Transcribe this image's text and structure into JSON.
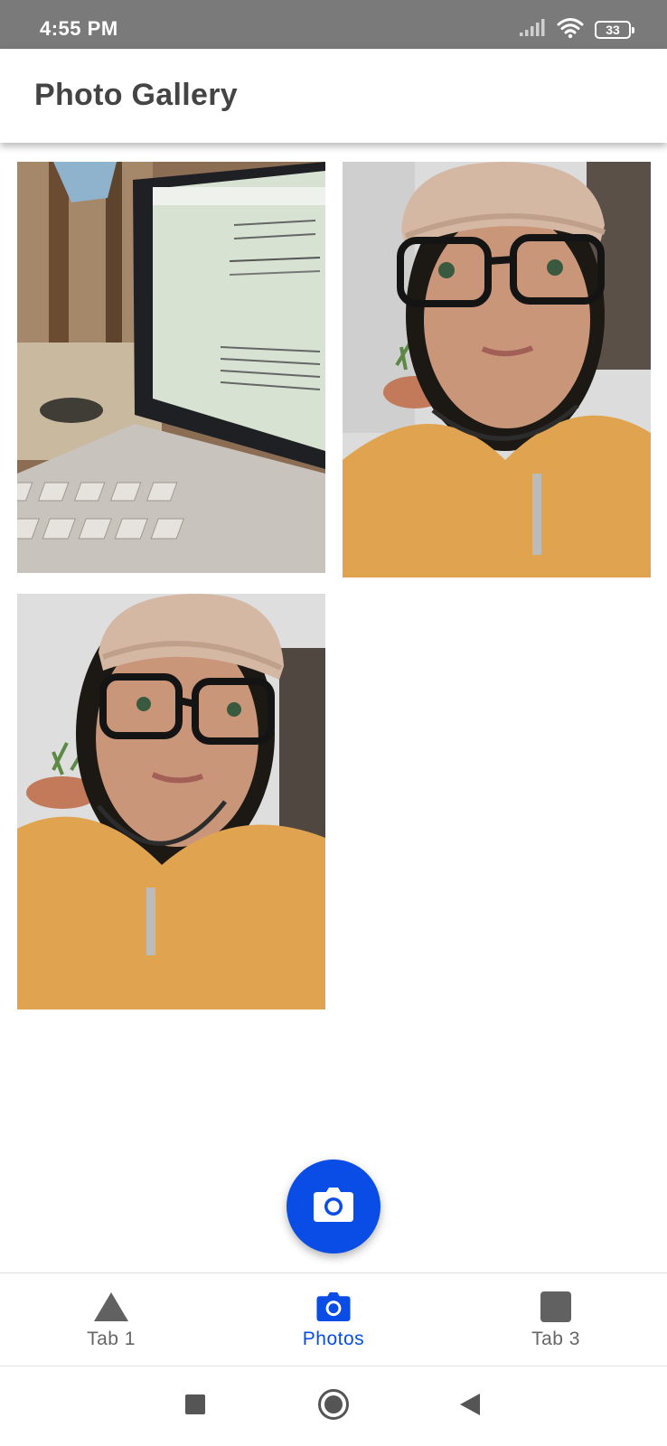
{
  "status_bar": {
    "time": "4:55 PM",
    "battery_level": "33",
    "icons": [
      "signal-icon",
      "wifi-icon",
      "battery-icon"
    ]
  },
  "header": {
    "title": "Photo Gallery"
  },
  "gallery": {
    "photos": [
      {
        "name": "photo-laptop",
        "subject": "laptop-with-document"
      },
      {
        "name": "photo-selfie-1",
        "subject": "selfie"
      },
      {
        "name": "photo-selfie-2",
        "subject": "selfie"
      }
    ]
  },
  "fab": {
    "icon": "camera-icon",
    "color": "#0a4de6"
  },
  "tabs": [
    {
      "label": "Tab 1",
      "icon": "triangle-icon",
      "active": false
    },
    {
      "label": "Photos",
      "icon": "camera-icon",
      "active": true
    },
    {
      "label": "Tab 3",
      "icon": "square-icon",
      "active": false
    }
  ],
  "system_nav": {
    "buttons": [
      "recent-apps-button",
      "home-button",
      "back-button"
    ]
  },
  "colors": {
    "accent": "#0a4de6",
    "status_bar": "#7a7a7a",
    "title_text": "#444444",
    "tab_inactive": "#666666"
  }
}
